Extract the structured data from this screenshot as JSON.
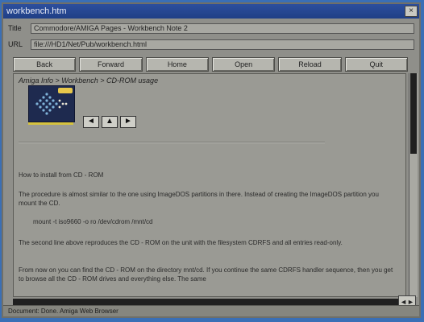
{
  "window": {
    "title": "workbench.htm",
    "close_label": "×"
  },
  "url_rows": [
    {
      "label": "Title",
      "value": "Commodore/AMIGA Pages - Workbench Note 2"
    },
    {
      "label": "URL",
      "value": "file:///HD1/Net/Pub/workbench.html"
    }
  ],
  "toolbar": {
    "buttons": [
      "Back",
      "Forward",
      "Home",
      "Open",
      "Reload",
      "Quit"
    ]
  },
  "content": {
    "breadcrumb": "Amiga Info > Workbench > CD-ROM usage",
    "nav": {
      "prev": "◄",
      "up": "▲",
      "next": "►"
    },
    "paragraphs": [
      "How to install from CD - ROM",
      "The procedure is almost similar to the one using ImageDOS partitions in there. Instead of creating the ImageDOS partition you mount the CD.",
      "mount -t iso9660 -o ro /dev/cdrom /mnt/cd",
      "The second line above reproduces the CD - ROM on the unit with the filesystem CDRFS and all entries read-only.",
      "From now on you can find the CD - ROM on the directory mnt/cd. If you continue the same CDRFS handler sequence, then you get to browse all the CD - ROM drives and everything else. The same"
    ]
  },
  "scrollbar": {
    "corner_label": "◄►"
  },
  "statusbar": {
    "text": "Document: Done.   Amiga Web Browser"
  }
}
